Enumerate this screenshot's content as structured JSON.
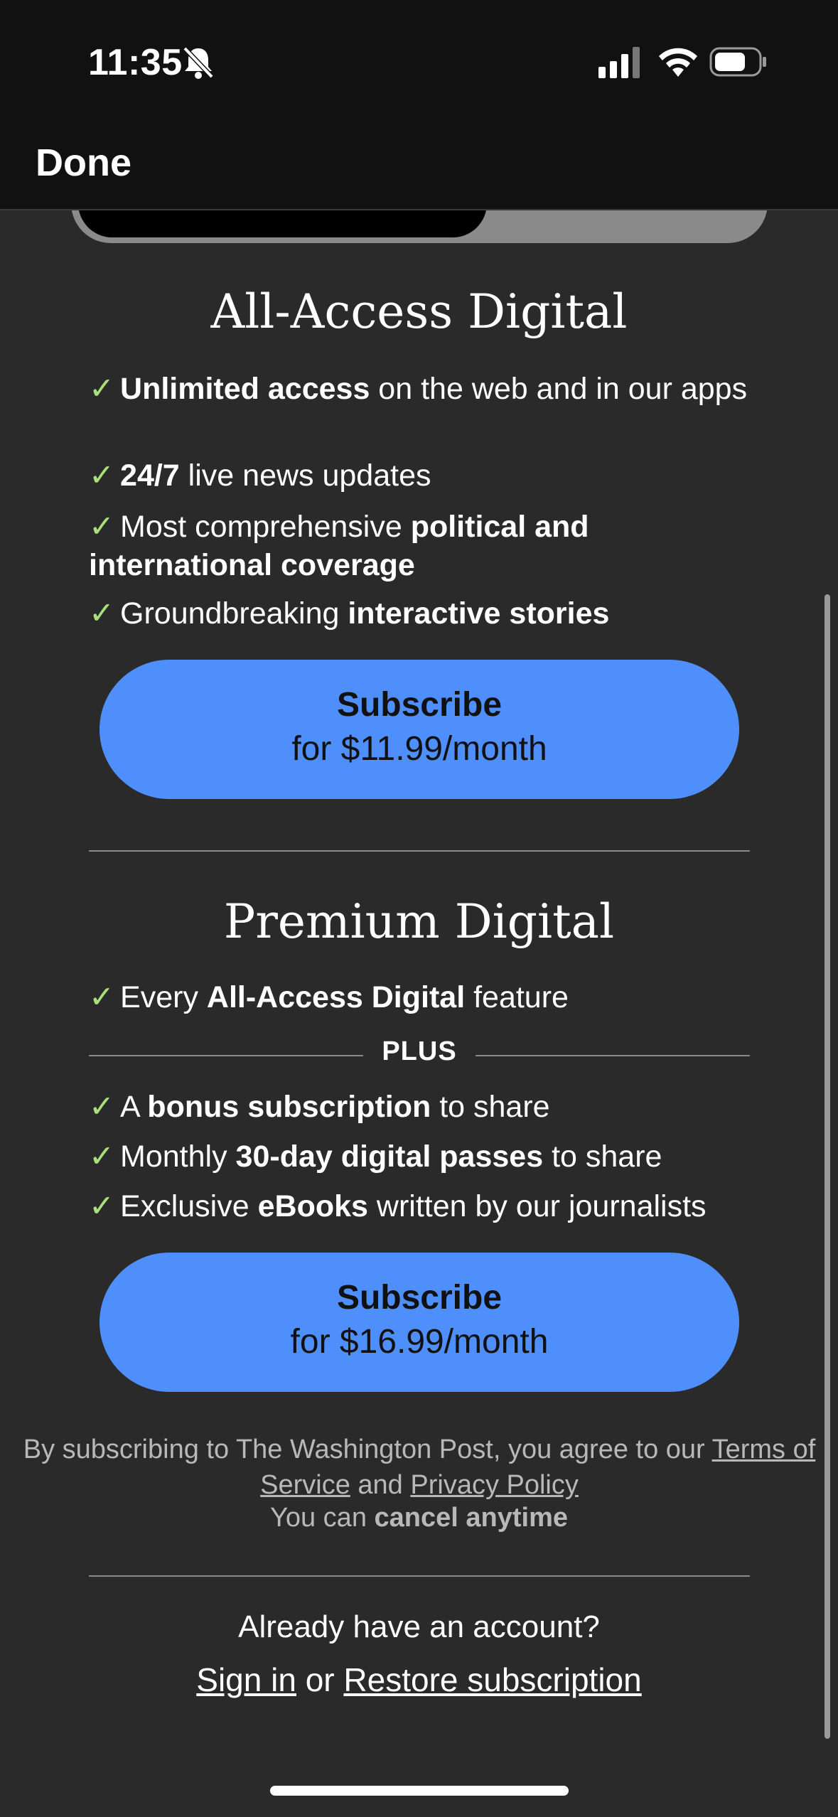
{
  "status_bar": {
    "time": "11:35",
    "icons": [
      "bell-slash-icon",
      "cellular-signal-icon",
      "wifi-icon",
      "battery-icon"
    ]
  },
  "nav": {
    "done_label": "Done"
  },
  "plans": [
    {
      "title": "All-Access Digital",
      "features": [
        {
          "bold": "Unlimited access",
          "text": " on the web and in our apps"
        },
        {
          "bold": "24/7",
          "text": " live news updates"
        },
        {
          "pre": "Most comprehensive ",
          "bold": "political and international coverage",
          "text": ""
        },
        {
          "pre": "Groundbreaking ",
          "bold": "interactive stories",
          "text": ""
        }
      ],
      "cta_label": "Subscribe",
      "cta_price": "for $11.99/month"
    },
    {
      "title": "Premium Digital",
      "features": [
        {
          "pre": "Every ",
          "bold": "All-Access Digital",
          "text": " feature"
        },
        {
          "pre": "A ",
          "bold": "bonus subscription",
          "text": " to share"
        },
        {
          "pre": "Monthly ",
          "bold": "30-day digital passes",
          "text": " to share"
        },
        {
          "pre": "Exclusive ",
          "bold": "eBooks",
          "text": " written by our journalists"
        }
      ],
      "plus_label": "PLUS",
      "cta_label": "Subscribe",
      "cta_price": "for $16.99/month"
    }
  ],
  "legal": {
    "pre": "By subscribing to The Washington Post, you agree to our ",
    "terms": "Terms of Service",
    "and": " and ",
    "privacy": "Privacy Policy",
    "cancel_pre": "You can ",
    "cancel_bold": "cancel anytime"
  },
  "account": {
    "question": "Already have an account?",
    "sign_in": "Sign in",
    "or": " or ",
    "restore": "Restore subscription"
  },
  "colors": {
    "background": "#2a2a2a",
    "header": "#111111",
    "accent": "#4e8ffb",
    "check": "#a8e07a"
  }
}
